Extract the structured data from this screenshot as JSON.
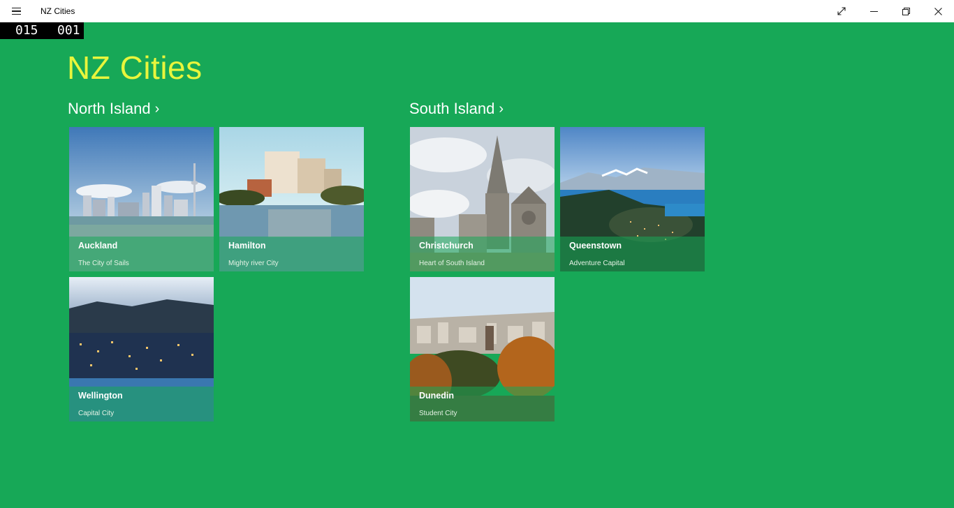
{
  "window": {
    "title": "NZ Cities",
    "controls": [
      "expand-icon",
      "minimize-icon",
      "restore-icon",
      "close-icon"
    ]
  },
  "counter": {
    "left": "015",
    "right": "001"
  },
  "page": {
    "title": "NZ Cities"
  },
  "groups": [
    {
      "header": "North Island",
      "cities": [
        {
          "name": "Auckland",
          "tagline": "The City of Sails"
        },
        {
          "name": "Hamilton",
          "tagline": "Mighty river City"
        },
        {
          "name": "Wellington",
          "tagline": "Capital City"
        }
      ]
    },
    {
      "header": "South Island",
      "cities": [
        {
          "name": "Christchurch",
          "tagline": "Heart of South Island"
        },
        {
          "name": "Queenstown",
          "tagline": "Adventure Capital"
        },
        {
          "name": "Dunedin",
          "tagline": "Student City"
        }
      ]
    }
  ],
  "colors": {
    "background": "#17a857",
    "title": "#e8f53c",
    "titlebar": "#ffffff"
  }
}
